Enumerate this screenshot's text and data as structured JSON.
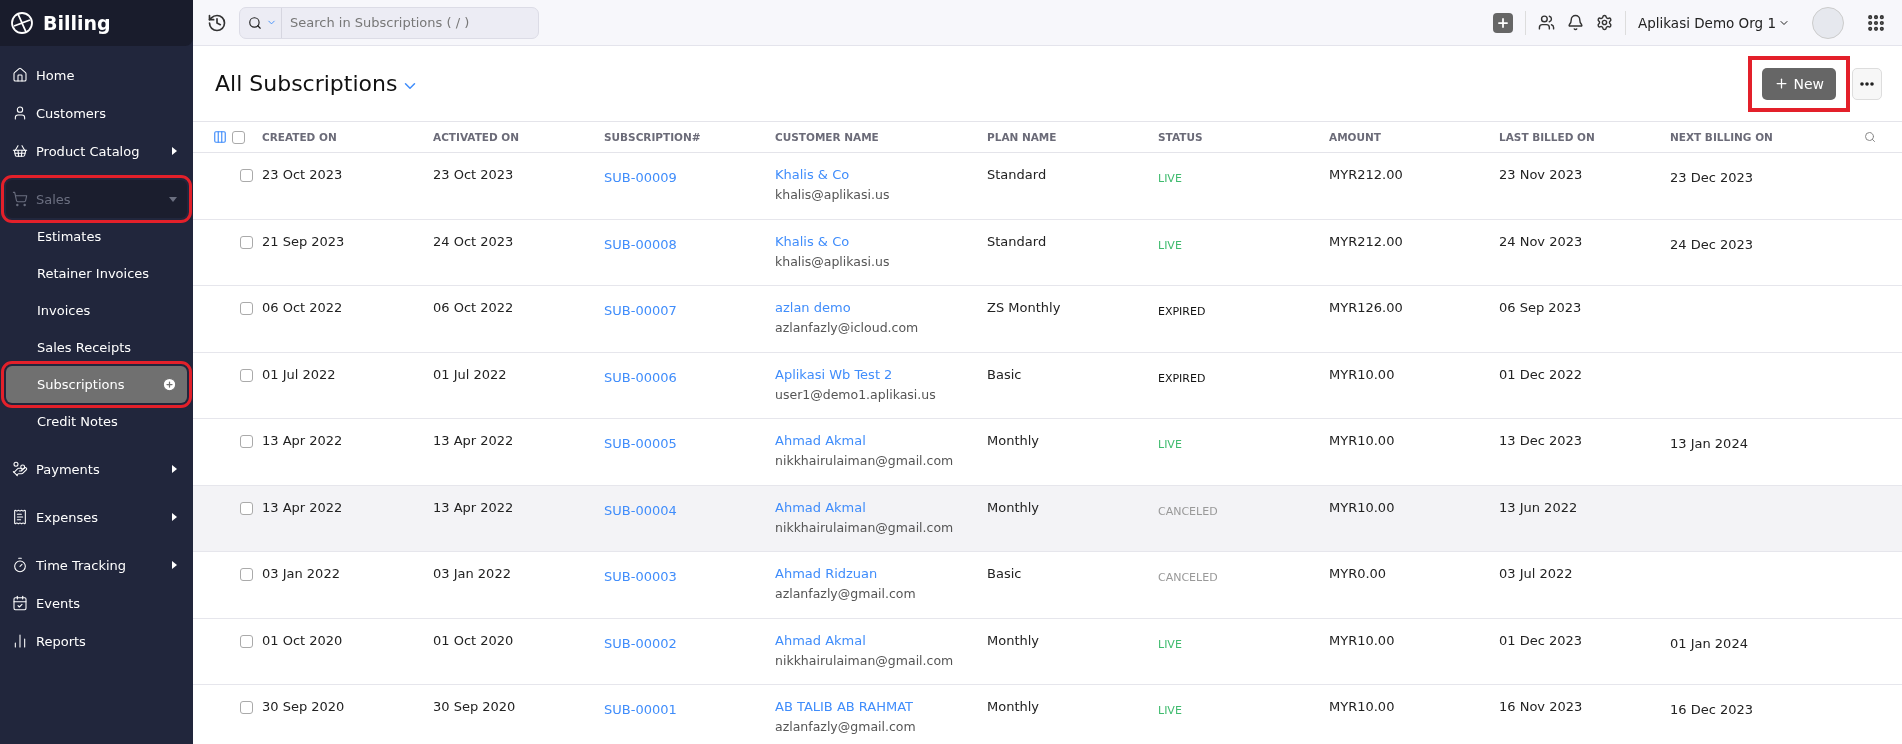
{
  "app": {
    "title": "Billing"
  },
  "sidebar": {
    "items": [
      {
        "kind": "item",
        "label": "Home",
        "selected": false
      },
      {
        "kind": "item",
        "label": "Customers",
        "selected": false
      },
      {
        "kind": "group",
        "label": "Product Catalog",
        "expanded": false,
        "selected": false
      },
      {
        "kind": "group",
        "label": "Sales",
        "expanded": true,
        "selected": false,
        "dimmed": true,
        "highlighted": true,
        "children": [
          {
            "label": "Estimates",
            "selected": false
          },
          {
            "label": "Retainer Invoices",
            "selected": false
          },
          {
            "label": "Invoices",
            "selected": false
          },
          {
            "label": "Sales Receipts",
            "selected": false
          },
          {
            "label": "Subscriptions",
            "selected": true,
            "highlighted": true
          },
          {
            "label": "Credit Notes",
            "selected": false
          }
        ]
      },
      {
        "kind": "group",
        "label": "Payments",
        "expanded": false,
        "selected": false
      },
      {
        "kind": "group",
        "label": "Expenses",
        "expanded": false,
        "selected": false
      },
      {
        "kind": "group",
        "label": "Time Tracking",
        "expanded": false,
        "selected": false
      },
      {
        "kind": "item",
        "label": "Events",
        "selected": false
      },
      {
        "kind": "item",
        "label": "Reports",
        "selected": false
      }
    ]
  },
  "topbar": {
    "search": {
      "placeholder": "Search in Subscriptions ( / )"
    },
    "org": "Aplikasi Demo Org 1"
  },
  "page": {
    "title": "All Subscriptions",
    "new_button": {
      "label": "New",
      "highlighted": true
    }
  },
  "table": {
    "select_all_checked": false,
    "columns": [
      "CREATED ON",
      "ACTIVATED ON",
      "SUBSCRIPTION#",
      "CUSTOMER NAME",
      "PLAN NAME",
      "STATUS",
      "AMOUNT",
      "LAST BILLED ON",
      "NEXT BILLING ON"
    ],
    "rows": [
      {
        "created": "23 Oct 2023",
        "activated": "23 Oct 2023",
        "subscription": "SUB-00009",
        "customer": "Khalis & Co",
        "email": "khalis@aplikasi.us",
        "plan": "Standard",
        "status": {
          "text": "LIVE",
          "kind": "live"
        },
        "amount": "MYR212.00",
        "last_billed": "23 Nov 2023",
        "next_billing": "23 Dec 2023",
        "checked": false,
        "highlighted": false
      },
      {
        "created": "21 Sep 2023",
        "activated": "24 Oct 2023",
        "subscription": "SUB-00008",
        "customer": "Khalis & Co",
        "email": "khalis@aplikasi.us",
        "plan": "Standard",
        "status": {
          "text": "LIVE",
          "kind": "live"
        },
        "amount": "MYR212.00",
        "last_billed": "24 Nov 2023",
        "next_billing": "24 Dec 2023",
        "checked": false,
        "highlighted": false
      },
      {
        "created": "06 Oct 2022",
        "activated": "06 Oct 2022",
        "subscription": "SUB-00007",
        "customer": "azlan demo",
        "email": "azlanfazly@icloud.com",
        "plan": "ZS Monthly",
        "status": {
          "text": "EXPIRED",
          "kind": "expired"
        },
        "amount": "MYR126.00",
        "last_billed": "06 Sep 2023",
        "checked": false,
        "highlighted": false
      },
      {
        "created": "01 Jul 2022",
        "activated": "01 Jul 2022",
        "subscription": "SUB-00006",
        "customer": "Aplikasi Wb Test 2",
        "email": "user1@demo1.aplikasi.us",
        "plan": "Basic",
        "status": {
          "text": "EXPIRED",
          "kind": "expired"
        },
        "amount": "MYR10.00",
        "last_billed": "01 Dec 2022",
        "checked": false,
        "highlighted": false
      },
      {
        "created": "13 Apr 2022",
        "activated": "13 Apr 2022",
        "subscription": "SUB-00005",
        "customer": "Ahmad Akmal",
        "email": "nikkhairulaiman@gmail.com",
        "plan": "Monthly",
        "status": {
          "text": "LIVE",
          "kind": "live"
        },
        "amount": "MYR10.00",
        "last_billed": "13 Dec 2023",
        "next_billing": "13 Jan 2024",
        "checked": false,
        "highlighted": false
      },
      {
        "created": "13 Apr 2022",
        "activated": "13 Apr 2022",
        "subscription": "SUB-00004",
        "customer": "Ahmad Akmal",
        "email": "nikkhairulaiman@gmail.com",
        "plan": "Monthly",
        "status": {
          "text": "CANCELED",
          "kind": "canceled"
        },
        "amount": "MYR10.00",
        "last_billed": "13 Jun 2022",
        "checked": false,
        "highlighted": true
      },
      {
        "created": "03 Jan 2022",
        "activated": "03 Jan 2022",
        "subscription": "SUB-00003",
        "customer": "Ahmad Ridzuan",
        "email": "azlanfazly@gmail.com",
        "plan": "Basic",
        "status": {
          "text": "CANCELED",
          "kind": "canceled"
        },
        "amount": "MYR0.00",
        "last_billed": "03 Jul 2022",
        "checked": false,
        "highlighted": false
      },
      {
        "created": "01 Oct 2020",
        "activated": "01 Oct 2020",
        "subscription": "SUB-00002",
        "customer": "Ahmad Akmal",
        "email": "nikkhairulaiman@gmail.com",
        "plan": "Monthly",
        "status": {
          "text": "LIVE",
          "kind": "live"
        },
        "amount": "MYR10.00",
        "last_billed": "01 Dec 2023",
        "next_billing": "01 Jan 2024",
        "checked": false,
        "highlighted": false
      },
      {
        "created": "30 Sep 2020",
        "activated": "30 Sep 2020",
        "subscription": "SUB-00001",
        "customer": "AB TALIB AB RAHMAT",
        "email": "azlanfazly@gmail.com",
        "plan": "Monthly",
        "status": {
          "text": "LIVE",
          "kind": "live"
        },
        "amount": "MYR10.00",
        "last_billed": "16 Nov 2023",
        "next_billing": "16 Dec 2023",
        "checked": false,
        "highlighted": false
      }
    ]
  }
}
